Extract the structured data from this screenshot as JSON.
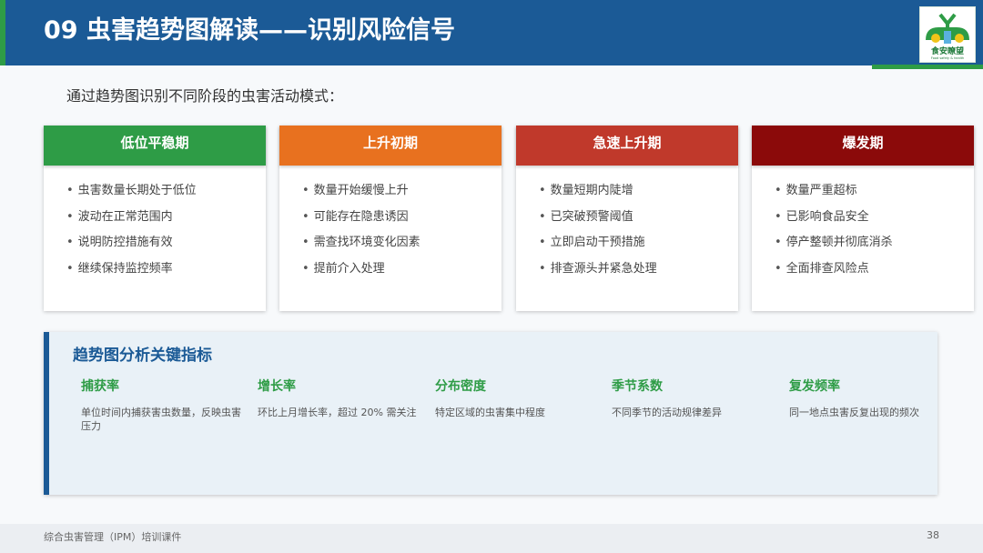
{
  "header": {
    "title": "09  虫害趋势图解读——识别风险信号",
    "logo_text": "食安瞭望",
    "logo_subtext": "Food safety & health",
    "colors": {
      "primary": "#1b5a96",
      "accent": "#2e9c46"
    }
  },
  "intro": "通过趋势图识别不同阶段的虫害活动模式：",
  "stages": [
    {
      "title": "低位平稳期",
      "color": "#2e9c46",
      "items": [
        "虫害数量长期处于低位",
        "波动在正常范围内",
        "说明防控措施有效",
        "继续保持监控频率"
      ]
    },
    {
      "title": "上升初期",
      "color": "#e8711f",
      "items": [
        "数量开始缓慢上升",
        "可能存在隐患诱因",
        "需查找环境变化因素",
        "提前介入处理"
      ]
    },
    {
      "title": "急速上升期",
      "color": "#c0392b",
      "items": [
        "数量短期内陡增",
        "已突破预警阈值",
        "立即启动干预措施",
        "排查源头并紧急处理"
      ]
    },
    {
      "title": "爆发期",
      "color": "#8b0a0a",
      "items": [
        "数量严重超标",
        "已影响食品安全",
        "停产整顿并彻底消杀",
        "全面排查风险点"
      ]
    }
  ],
  "indicators": {
    "title": "趋势图分析关键指标",
    "items": [
      {
        "name": "捕获率",
        "desc": "单位时间内捕获害虫数量，反映虫害压力"
      },
      {
        "name": "增长率",
        "desc": "环比上月增长率，超过 20% 需关注"
      },
      {
        "name": "分布密度",
        "desc": "特定区域的虫害集中程度"
      },
      {
        "name": "季节系数",
        "desc": "不同季节的活动规律差异"
      },
      {
        "name": "复发频率",
        "desc": "同一地点虫害反复出现的频次"
      }
    ]
  },
  "footer": {
    "course": "综合虫害管理（IPM）培训课件",
    "page_number": "38"
  }
}
